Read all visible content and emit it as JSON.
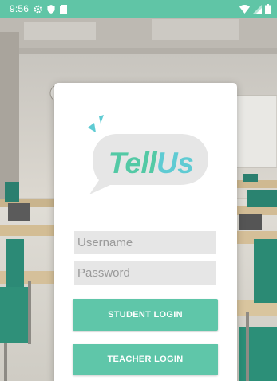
{
  "status_bar": {
    "time": "9:56",
    "left_icons": [
      "settings-icon",
      "shield-icon",
      "sd-card-icon"
    ],
    "right_icons": [
      "wifi-icon",
      "cell-signal-icon",
      "battery-icon"
    ],
    "background_color": "#60c5a6"
  },
  "logo": {
    "part1": "Tell",
    "part2": "Us",
    "color_part1": "#53c9a5",
    "color_part2": "#5fcbd3"
  },
  "login": {
    "username_placeholder": "Username",
    "password_placeholder": "Password",
    "student_button_label": "STUDENT LOGIN",
    "teacher_button_label": "TEACHER LOGIN"
  },
  "theme": {
    "accent": "#5fc6a9",
    "field_background": "#e6e6e6"
  }
}
